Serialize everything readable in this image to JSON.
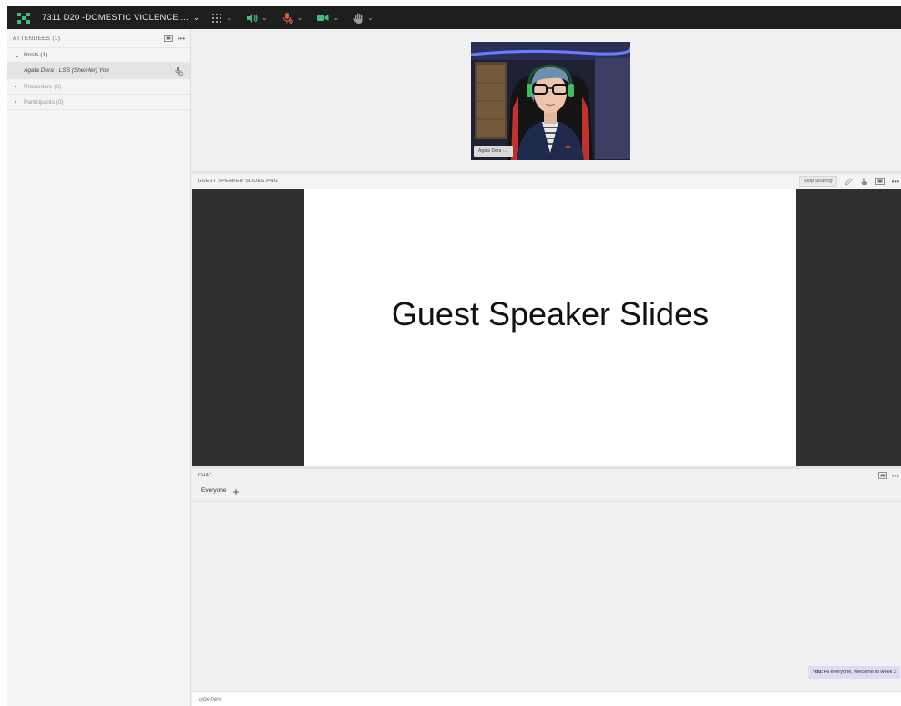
{
  "topbar": {
    "meeting_title": "7311 D20 -DOMESTIC VIOLENCE ...",
    "title_chevron": "⌄",
    "layouts_icon": "grid-icon",
    "audio_icon": "speaker-icon",
    "mic_icon": "mic-muted-icon",
    "camera_icon": "camera-icon",
    "raise_hand_icon": "hand-icon",
    "accent": "#3fbf7f",
    "muted_color": "#e05a3c"
  },
  "attendees": {
    "header": "ATTENDEES (1)",
    "more": "•••",
    "hosts_label": "Hosts (1)",
    "host_name": "Agata Dera - LSS (She/Her) You",
    "presenters_label": "Presenters (0)",
    "participants_label": "Participants (0)"
  },
  "video": {
    "name_tag": "Agata Dera -..."
  },
  "share": {
    "file_name": "GUEST SPEAKER SLIDES.PNG",
    "stop_sharing": "Stop Sharing",
    "more": "•••",
    "slide_title": "Guest Speaker Slides"
  },
  "chat": {
    "header": "CHAT",
    "more": "•••",
    "tab_everyone": "Everyone",
    "tab_add": "+",
    "message_sender": "You:",
    "message_text": " Hi everyone, welcome to week 3",
    "input_placeholder": "Type here"
  }
}
